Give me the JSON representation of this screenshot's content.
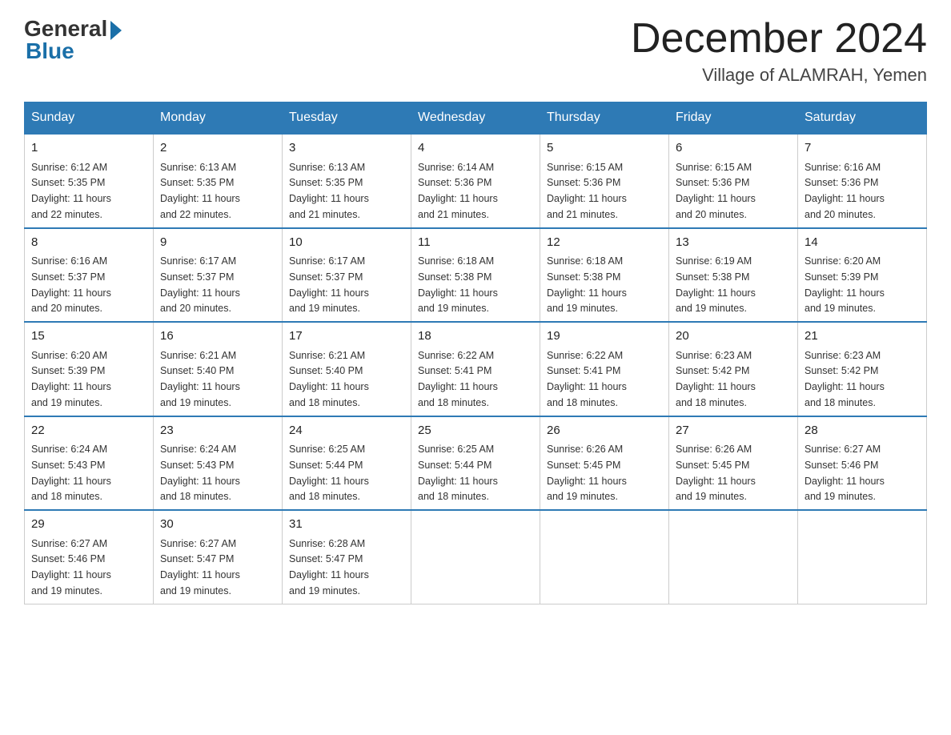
{
  "header": {
    "logo_general": "General",
    "logo_blue": "Blue",
    "month_title": "December 2024",
    "location": "Village of ALAMRAH, Yemen"
  },
  "days_of_week": [
    "Sunday",
    "Monday",
    "Tuesday",
    "Wednesday",
    "Thursday",
    "Friday",
    "Saturday"
  ],
  "weeks": [
    [
      {
        "day": "1",
        "sunrise": "6:12 AM",
        "sunset": "5:35 PM",
        "daylight": "11 hours and 22 minutes."
      },
      {
        "day": "2",
        "sunrise": "6:13 AM",
        "sunset": "5:35 PM",
        "daylight": "11 hours and 22 minutes."
      },
      {
        "day": "3",
        "sunrise": "6:13 AM",
        "sunset": "5:35 PM",
        "daylight": "11 hours and 21 minutes."
      },
      {
        "day": "4",
        "sunrise": "6:14 AM",
        "sunset": "5:36 PM",
        "daylight": "11 hours and 21 minutes."
      },
      {
        "day": "5",
        "sunrise": "6:15 AM",
        "sunset": "5:36 PM",
        "daylight": "11 hours and 21 minutes."
      },
      {
        "day": "6",
        "sunrise": "6:15 AM",
        "sunset": "5:36 PM",
        "daylight": "11 hours and 20 minutes."
      },
      {
        "day": "7",
        "sunrise": "6:16 AM",
        "sunset": "5:36 PM",
        "daylight": "11 hours and 20 minutes."
      }
    ],
    [
      {
        "day": "8",
        "sunrise": "6:16 AM",
        "sunset": "5:37 PM",
        "daylight": "11 hours and 20 minutes."
      },
      {
        "day": "9",
        "sunrise": "6:17 AM",
        "sunset": "5:37 PM",
        "daylight": "11 hours and 20 minutes."
      },
      {
        "day": "10",
        "sunrise": "6:17 AM",
        "sunset": "5:37 PM",
        "daylight": "11 hours and 19 minutes."
      },
      {
        "day": "11",
        "sunrise": "6:18 AM",
        "sunset": "5:38 PM",
        "daylight": "11 hours and 19 minutes."
      },
      {
        "day": "12",
        "sunrise": "6:18 AM",
        "sunset": "5:38 PM",
        "daylight": "11 hours and 19 minutes."
      },
      {
        "day": "13",
        "sunrise": "6:19 AM",
        "sunset": "5:38 PM",
        "daylight": "11 hours and 19 minutes."
      },
      {
        "day": "14",
        "sunrise": "6:20 AM",
        "sunset": "5:39 PM",
        "daylight": "11 hours and 19 minutes."
      }
    ],
    [
      {
        "day": "15",
        "sunrise": "6:20 AM",
        "sunset": "5:39 PM",
        "daylight": "11 hours and 19 minutes."
      },
      {
        "day": "16",
        "sunrise": "6:21 AM",
        "sunset": "5:40 PM",
        "daylight": "11 hours and 19 minutes."
      },
      {
        "day": "17",
        "sunrise": "6:21 AM",
        "sunset": "5:40 PM",
        "daylight": "11 hours and 18 minutes."
      },
      {
        "day": "18",
        "sunrise": "6:22 AM",
        "sunset": "5:41 PM",
        "daylight": "11 hours and 18 minutes."
      },
      {
        "day": "19",
        "sunrise": "6:22 AM",
        "sunset": "5:41 PM",
        "daylight": "11 hours and 18 minutes."
      },
      {
        "day": "20",
        "sunrise": "6:23 AM",
        "sunset": "5:42 PM",
        "daylight": "11 hours and 18 minutes."
      },
      {
        "day": "21",
        "sunrise": "6:23 AM",
        "sunset": "5:42 PM",
        "daylight": "11 hours and 18 minutes."
      }
    ],
    [
      {
        "day": "22",
        "sunrise": "6:24 AM",
        "sunset": "5:43 PM",
        "daylight": "11 hours and 18 minutes."
      },
      {
        "day": "23",
        "sunrise": "6:24 AM",
        "sunset": "5:43 PM",
        "daylight": "11 hours and 18 minutes."
      },
      {
        "day": "24",
        "sunrise": "6:25 AM",
        "sunset": "5:44 PM",
        "daylight": "11 hours and 18 minutes."
      },
      {
        "day": "25",
        "sunrise": "6:25 AM",
        "sunset": "5:44 PM",
        "daylight": "11 hours and 18 minutes."
      },
      {
        "day": "26",
        "sunrise": "6:26 AM",
        "sunset": "5:45 PM",
        "daylight": "11 hours and 19 minutes."
      },
      {
        "day": "27",
        "sunrise": "6:26 AM",
        "sunset": "5:45 PM",
        "daylight": "11 hours and 19 minutes."
      },
      {
        "day": "28",
        "sunrise": "6:27 AM",
        "sunset": "5:46 PM",
        "daylight": "11 hours and 19 minutes."
      }
    ],
    [
      {
        "day": "29",
        "sunrise": "6:27 AM",
        "sunset": "5:46 PM",
        "daylight": "11 hours and 19 minutes."
      },
      {
        "day": "30",
        "sunrise": "6:27 AM",
        "sunset": "5:47 PM",
        "daylight": "11 hours and 19 minutes."
      },
      {
        "day": "31",
        "sunrise": "6:28 AM",
        "sunset": "5:47 PM",
        "daylight": "11 hours and 19 minutes."
      },
      null,
      null,
      null,
      null
    ]
  ],
  "sunrise_label": "Sunrise:",
  "sunset_label": "Sunset:",
  "daylight_label": "Daylight:"
}
